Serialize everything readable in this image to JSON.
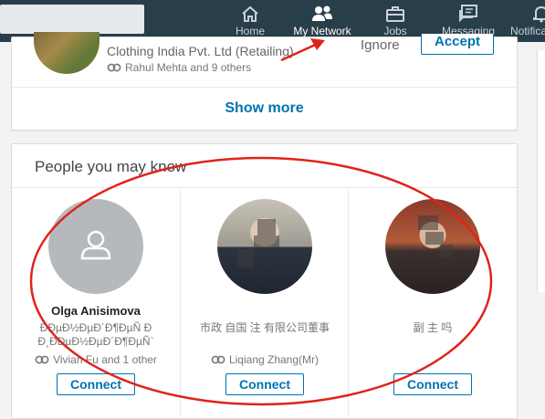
{
  "nav": {
    "items": [
      {
        "label": "Home",
        "icon": "home-icon"
      },
      {
        "label": "My Network",
        "icon": "network-icon"
      },
      {
        "label": "Jobs",
        "icon": "briefcase-icon"
      },
      {
        "label": "Messaging",
        "icon": "messaging-icon"
      },
      {
        "label": "Notifica",
        "icon": "bell-icon"
      }
    ],
    "active": "My Network"
  },
  "invitation": {
    "company": "Clothing India Pvt. Ltd (Retailing)",
    "mutual": "Rahul Mehta and 9 others",
    "ignore_label": "Ignore",
    "accept_label": "Accept"
  },
  "show_more_label": "Show more",
  "pymk": {
    "title": "People you may know",
    "people": [
      {
        "name": "Olga Anisimova",
        "headline_1": "ÐÐµÐ½ÐµÐ´Ð¶ÐµÑ Ð",
        "headline_2": "Ð¸ÐÐµÐ½ÐµÐ´Ð¶ÐµÑ`",
        "mutual": "Vivian Fu and 1 other",
        "connect_label": "Connect"
      },
      {
        "name": "",
        "headline_1": "市政  自国  注  有限公司董事",
        "headline_2": "",
        "mutual": "Liqiang Zhang(Mr)",
        "connect_label": "Connect"
      },
      {
        "name": "",
        "headline_1": "副  主  吗",
        "headline_2": "",
        "mutual": "",
        "connect_label": "Connect"
      }
    ]
  },
  "colors": {
    "nav_bg": "#283e4a",
    "accent": "#0073b1",
    "annotation": "#e0231a"
  }
}
